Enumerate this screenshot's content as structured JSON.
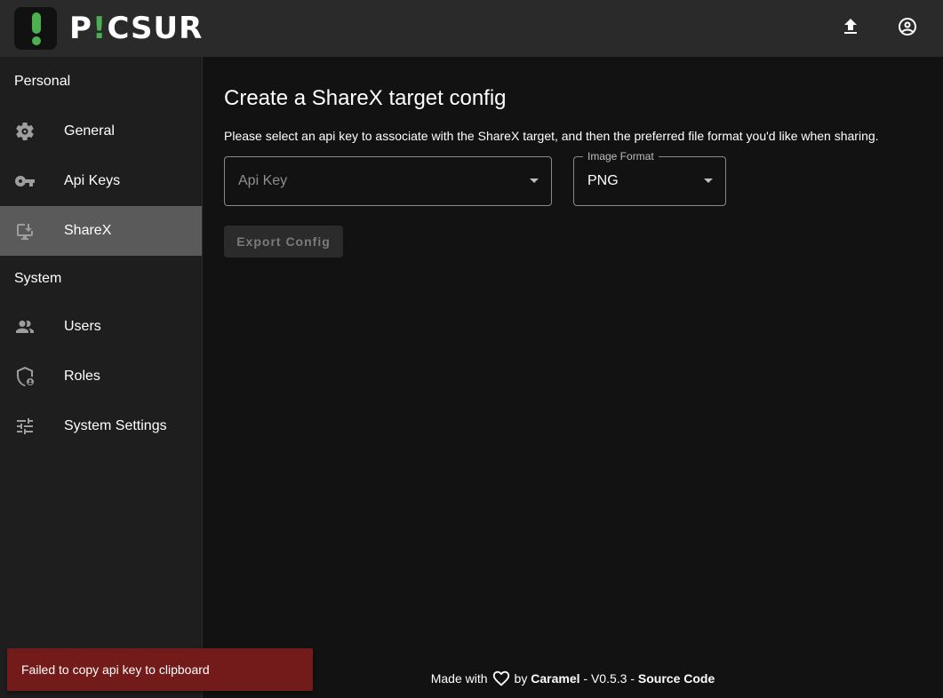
{
  "app": {
    "logo_text_prefix": "P",
    "logo_text_excl": "!",
    "logo_text_suffix": "CSUR",
    "accent_color": "#4caf50"
  },
  "header": {
    "upload_icon": "upload-icon",
    "account_icon": "account-circle-icon"
  },
  "sidebar": {
    "sections": [
      {
        "title": "Personal",
        "items": [
          {
            "label": "General",
            "icon": "gear-icon"
          },
          {
            "label": "Api Keys",
            "icon": "key-icon"
          },
          {
            "label": "ShareX",
            "icon": "download-screen-icon",
            "active": true
          }
        ]
      },
      {
        "title": "System",
        "items": [
          {
            "label": "Users",
            "icon": "users-icon"
          },
          {
            "label": "Roles",
            "icon": "shield-lock-icon"
          },
          {
            "label": "System Settings",
            "icon": "tune-icon"
          }
        ]
      }
    ]
  },
  "main": {
    "title": "Create a ShareX target config",
    "description": "Please select an api key to associate with the ShareX target, and then the preferred file format you'd like when sharing.",
    "api_key_select": {
      "placeholder": "Api Key"
    },
    "image_format_select": {
      "label": "Image Format",
      "value": "PNG"
    },
    "export_button": "Export Config"
  },
  "footer": {
    "made_with": "Made with",
    "by": "by",
    "author": "Caramel",
    "separator": "-",
    "version": "V0.5.3",
    "separator2": "-",
    "source": "Source Code"
  },
  "snackbar": {
    "message": "Failed to copy api key to clipboard",
    "color": "#731a1a"
  }
}
